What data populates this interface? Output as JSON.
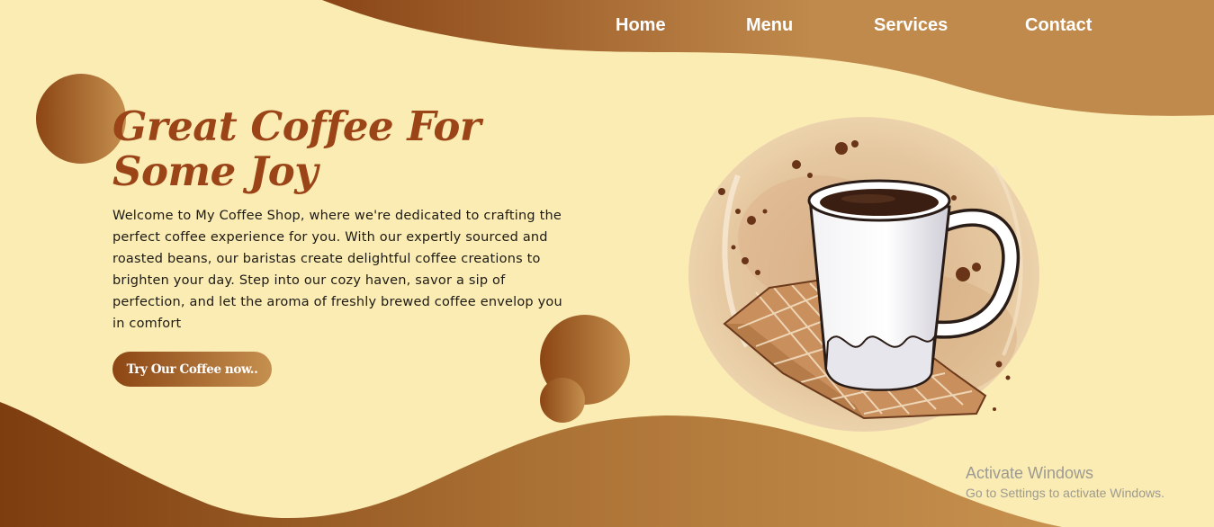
{
  "nav": {
    "items": [
      {
        "label": "Home"
      },
      {
        "label": "Menu"
      },
      {
        "label": "Services"
      },
      {
        "label": "Contact"
      }
    ]
  },
  "hero": {
    "title": "Great Coffee For Some Joy",
    "description": "Welcome to My Coffee Shop, where we're dedicated to crafting the perfect coffee experience for you. With our expertly sourced and roasted beans, our baristas create delightful coffee creations to brighten your day. Step into our cozy haven, savor a sip of perfection, and let the aroma of freshly brewed coffee envelop you in comfort",
    "cta_label": "Try Our Coffee now.."
  },
  "illustration": {
    "subject": "coffee-mug-on-napkin-watercolor"
  },
  "watermark": {
    "title": "Activate Windows",
    "subtitle": "Go to Settings to activate Windows."
  },
  "colors": {
    "background": "#fbecb3",
    "brown_dark": "#8c4614",
    "brown_light": "#c5904f",
    "title": "#9a4418",
    "nav_text": "#ffffff"
  }
}
